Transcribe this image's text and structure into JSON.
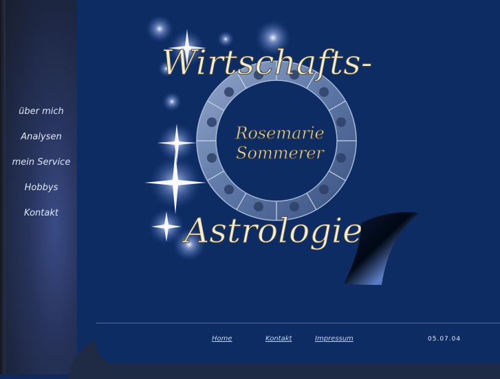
{
  "colors": {
    "background": "#0d2c63",
    "sidebar": "#27335c",
    "text": "#dfe6f4",
    "logo_text": "#f2ecd2"
  },
  "logo": {
    "title_top": "Wirtschafts-",
    "title_bottom": "Astrologie",
    "name_line1": "Rosemarie",
    "name_line2": "Sommerer",
    "icons": [
      "zodiac-wheel-icon",
      "star-icon"
    ]
  },
  "nav": {
    "items": [
      {
        "label": "über mich"
      },
      {
        "label": "Analysen"
      },
      {
        "label": "mein Service"
      },
      {
        "label": "Hobbys"
      },
      {
        "label": "Kontakt"
      }
    ]
  },
  "footer": {
    "home": "Home",
    "kontakt": "Kontakt",
    "impressum": "Impressum",
    "date": "05.07.04"
  }
}
